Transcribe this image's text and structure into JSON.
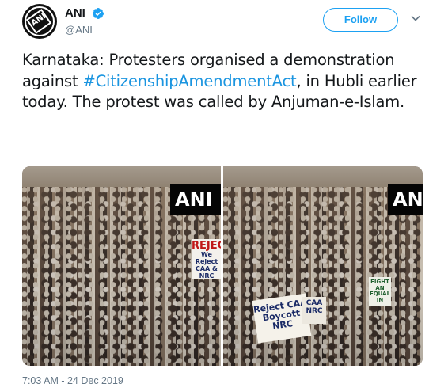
{
  "author": {
    "display_name": "ANI",
    "handle": "@ANI",
    "verified": true,
    "avatar_icon": "ani-logo-icon",
    "avatar_logo_text": "ANI"
  },
  "actions": {
    "follow_label": "Follow",
    "more_icon": "chevron-down-icon"
  },
  "tweet": {
    "text_before": "Karnataka: Protesters organised a demonstration against ",
    "hashtag": "#CitizenshipAmendmentAct",
    "text_after": ", in Hubli earlier today. The protest was called by Anjuman-e-Islam.",
    "timestamp": "7:03 AM - 24 Dec 2019"
  },
  "media": {
    "photo_left": {
      "watermark": "ANI",
      "signs": [
        "REJEC",
        "We Reject CAA & NRC"
      ]
    },
    "photo_right": {
      "watermark": "AN",
      "signs": [
        "Reject CAA",
        "Boycott NRC",
        "CAA NRC",
        "FIGHT AN EQUAL IN"
      ]
    }
  },
  "colors": {
    "link": "#1b95e0",
    "follow_border": "#1da1f2",
    "secondary_text": "#657786",
    "primary_text": "#14171a",
    "verified_badge": "#1da1f2"
  }
}
